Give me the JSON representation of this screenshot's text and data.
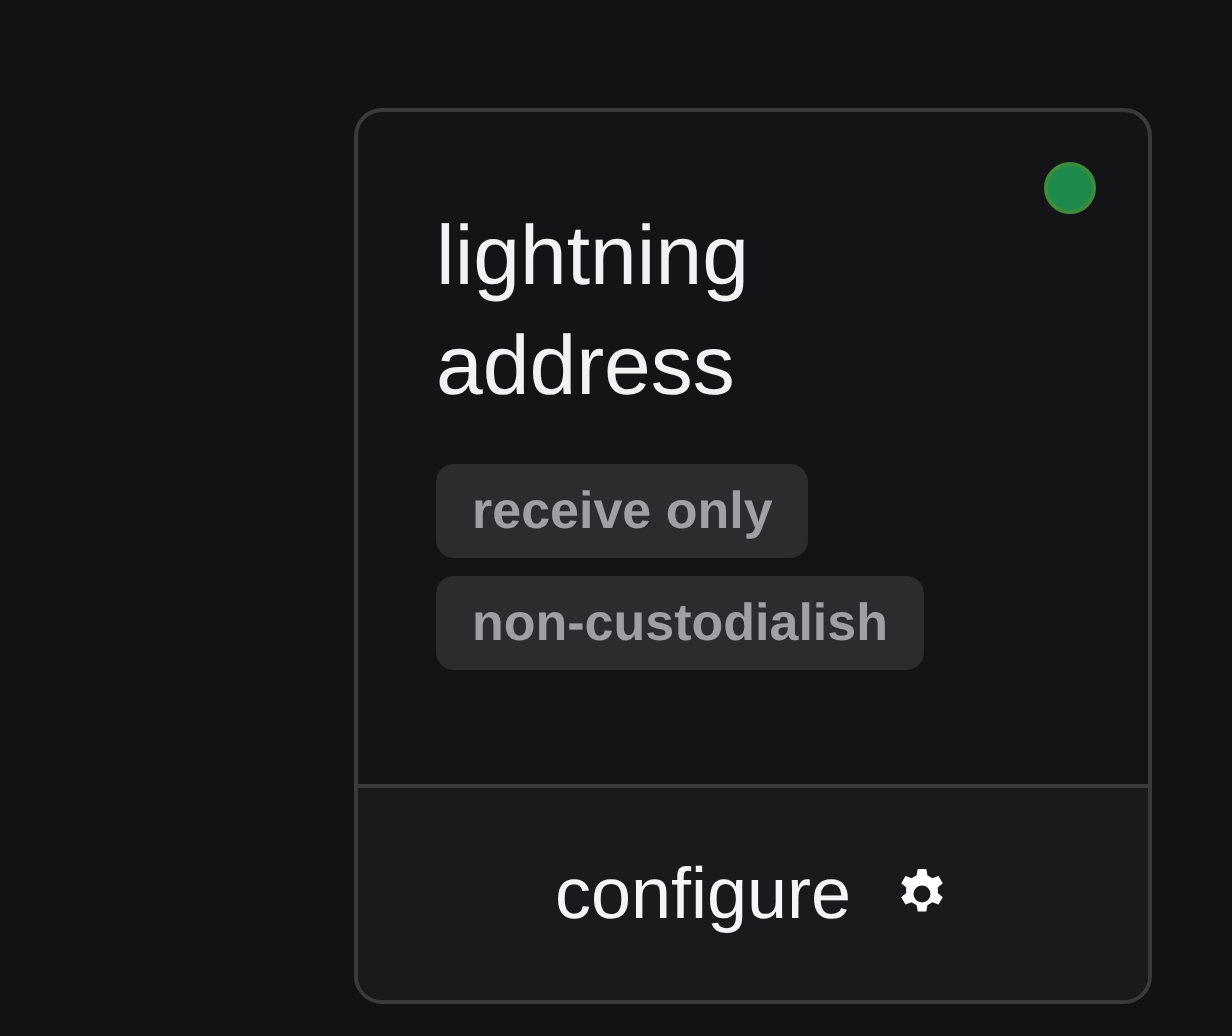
{
  "card": {
    "title": "lightning address",
    "status": {
      "color": "#1e8a4c"
    },
    "tags": [
      "receive only",
      "non-custodialish"
    ],
    "footer_button": {
      "label": "configure"
    }
  }
}
